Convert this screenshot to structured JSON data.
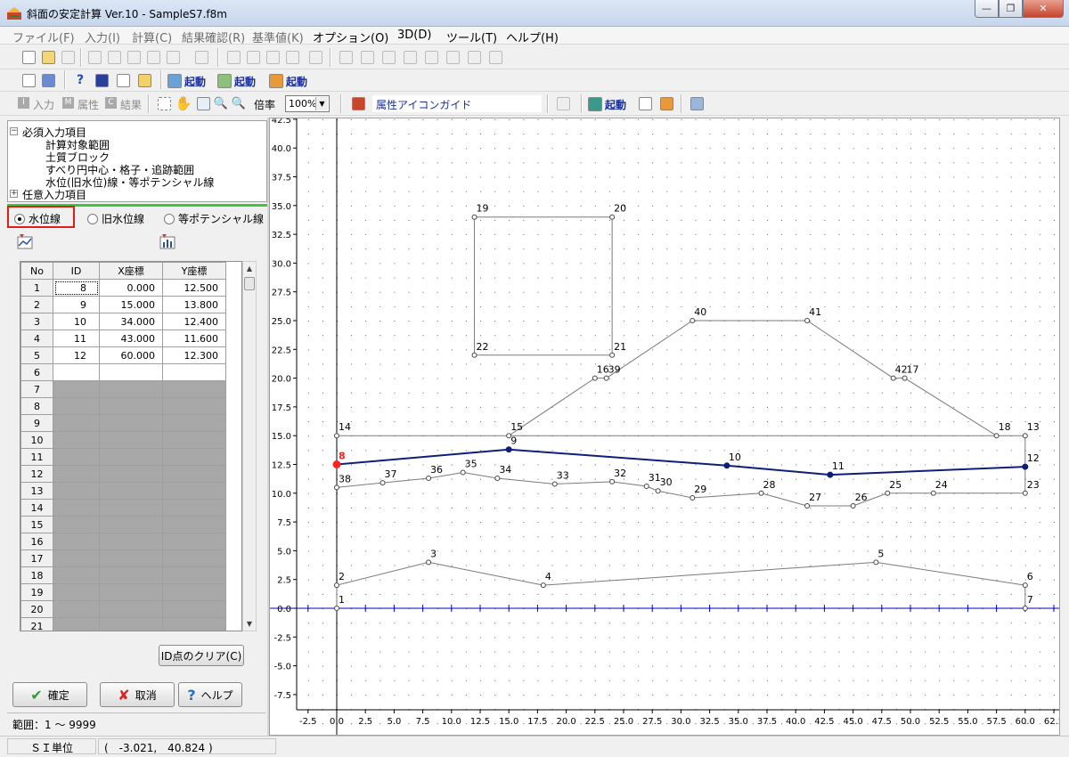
{
  "window": {
    "title": "斜面の安定計算 Ver.10 - SampleS7.f8m",
    "minimize": "—",
    "maximize": "❐",
    "close": "✕"
  },
  "menu": [
    "ファイル(F)",
    "入力(I)",
    "計算(C)",
    "結果確認(R)",
    "基準値(K)",
    "オプション(O)",
    "3D(D)",
    "ツール(T)",
    "ヘルプ(H)"
  ],
  "toolbar": {
    "kido1": "起動",
    "kido2": "起動",
    "kido3": "起動",
    "kido4": "起動",
    "input_label": "入力",
    "attr_label": "属性",
    "result_label": "結果",
    "scale_label": "倍率",
    "scale_value": "100%",
    "guide_label": "属性アイコンガイド"
  },
  "tree": {
    "root1": "必須入力項目",
    "child1": "計算対象範囲",
    "child2": "土質ブロック",
    "child3": "すべり円中心・格子・追跡範囲",
    "child4": "水位(旧水位)線・等ポテンシャル線",
    "root2": "任意入力項目"
  },
  "radios": {
    "r1": "水位線",
    "r2": "旧水位線",
    "r3": "等ポテンシャル線"
  },
  "table": {
    "headers": [
      "No",
      "ID",
      "X座標",
      "Y座標"
    ],
    "rows": [
      {
        "no": "1",
        "id": "8",
        "x": "0.000",
        "y": "12.500"
      },
      {
        "no": "2",
        "id": "9",
        "x": "15.000",
        "y": "13.800"
      },
      {
        "no": "3",
        "id": "10",
        "x": "34.000",
        "y": "12.400"
      },
      {
        "no": "4",
        "id": "11",
        "x": "43.000",
        "y": "11.600"
      },
      {
        "no": "5",
        "id": "12",
        "x": "60.000",
        "y": "12.300"
      },
      {
        "no": "6",
        "id": "",
        "x": "",
        "y": ""
      },
      {
        "no": "7"
      },
      {
        "no": "8"
      },
      {
        "no": "9"
      },
      {
        "no": "10"
      },
      {
        "no": "11"
      },
      {
        "no": "12"
      },
      {
        "no": "13"
      },
      {
        "no": "14"
      },
      {
        "no": "15"
      },
      {
        "no": "16"
      },
      {
        "no": "17"
      },
      {
        "no": "18"
      },
      {
        "no": "19"
      },
      {
        "no": "20"
      },
      {
        "no": "21"
      }
    ]
  },
  "buttons": {
    "clear": "ID点のクリア(C)",
    "ok": "確定",
    "cancel": "取消",
    "help": "ヘルプ"
  },
  "range_text": "範囲：1 ～ 9999",
  "status": {
    "unit": "ＳＩ単位",
    "coords": "(　-3.021,　40.824 )"
  },
  "plot": {
    "x_ticks": [
      "-2.5",
      "0.0",
      "2.5",
      "5.0",
      "7.5",
      "10.0",
      "12.5",
      "15.0",
      "17.5",
      "20.0",
      "22.5",
      "25.0",
      "27.5",
      "30.0",
      "32.5",
      "35.0",
      "37.5",
      "40.0",
      "42.5",
      "45.0",
      "47.5",
      "50.0",
      "52.5",
      "55.0",
      "57.5",
      "60.0",
      "62.5"
    ],
    "y_ticks": [
      "42.5",
      "40.0",
      "37.5",
      "35.0",
      "32.5",
      "30.0",
      "27.5",
      "25.0",
      "22.5",
      "20.0",
      "17.5",
      "15.0",
      "12.5",
      "10.0",
      "7.5",
      "5.0",
      "2.5",
      "0.0",
      "-2.5",
      "-5.0",
      "-7.5"
    ],
    "points": [
      {
        "id": "1",
        "x": 0,
        "y": 0
      },
      {
        "id": "2",
        "x": 0,
        "y": 2
      },
      {
        "id": "3",
        "x": 8,
        "y": 4
      },
      {
        "id": "4",
        "x": 18,
        "y": 2
      },
      {
        "id": "5",
        "x": 47,
        "y": 4
      },
      {
        "id": "6",
        "x": 60,
        "y": 2
      },
      {
        "id": "7",
        "x": 60,
        "y": 0
      },
      {
        "id": "8",
        "x": 0,
        "y": 12.5
      },
      {
        "id": "9",
        "x": 15,
        "y": 13.8
      },
      {
        "id": "10",
        "x": 34,
        "y": 12.4
      },
      {
        "id": "11",
        "x": 43,
        "y": 11.6
      },
      {
        "id": "12",
        "x": 60,
        "y": 12.3
      },
      {
        "id": "13",
        "x": 60,
        "y": 15
      },
      {
        "id": "14",
        "x": 0,
        "y": 15
      },
      {
        "id": "15",
        "x": 15,
        "y": 15
      },
      {
        "id": "16",
        "x": 22.5,
        "y": 20
      },
      {
        "id": "39",
        "x": 23.5,
        "y": 20
      },
      {
        "id": "40",
        "x": 31,
        "y": 25
      },
      {
        "id": "41",
        "x": 41,
        "y": 25
      },
      {
        "id": "42",
        "x": 48.5,
        "y": 20
      },
      {
        "id": "17",
        "x": 49.5,
        "y": 20
      },
      {
        "id": "18",
        "x": 57.5,
        "y": 15
      },
      {
        "id": "19",
        "x": 12,
        "y": 34
      },
      {
        "id": "20",
        "x": 24,
        "y": 34
      },
      {
        "id": "21",
        "x": 24,
        "y": 22
      },
      {
        "id": "22",
        "x": 12,
        "y": 22
      },
      {
        "id": "38",
        "x": 0,
        "y": 10.5
      },
      {
        "id": "37",
        "x": 4,
        "y": 10.9
      },
      {
        "id": "36",
        "x": 8,
        "y": 11.3
      },
      {
        "id": "35",
        "x": 11,
        "y": 11.8
      },
      {
        "id": "34",
        "x": 14,
        "y": 11.3
      },
      {
        "id": "33",
        "x": 19,
        "y": 10.8
      },
      {
        "id": "32",
        "x": 24,
        "y": 11
      },
      {
        "id": "31",
        "x": 27,
        "y": 10.6
      },
      {
        "id": "30",
        "x": 28,
        "y": 10.2
      },
      {
        "id": "29",
        "x": 31,
        "y": 9.6
      },
      {
        "id": "28",
        "x": 37,
        "y": 10
      },
      {
        "id": "27",
        "x": 41,
        "y": 8.9
      },
      {
        "id": "26",
        "x": 45,
        "y": 8.9
      },
      {
        "id": "25",
        "x": 48,
        "y": 10
      },
      {
        "id": "24",
        "x": 52,
        "y": 10
      },
      {
        "id": "23",
        "x": 60,
        "y": 10
      }
    ],
    "lines": [
      [
        "1",
        "2",
        "3",
        "4",
        "5",
        "6",
        "7"
      ],
      [
        "38",
        "37",
        "36",
        "35",
        "34",
        "33",
        "32",
        "31",
        "30",
        "29",
        "28",
        "27",
        "26",
        "25",
        "24",
        "23"
      ],
      [
        "14",
        "15",
        "13"
      ],
      [
        "15",
        "16",
        "39",
        "40",
        "41",
        "42",
        "17",
        "18"
      ],
      [
        "19",
        "20",
        "21",
        "22",
        "19"
      ],
      [
        "23",
        "13"
      ]
    ],
    "water_line": [
      "8",
      "9",
      "10",
      "11",
      "12"
    ],
    "colors": {
      "water": "#0d1f7a",
      "line": "#7a7a7a",
      "axis": "#0000cc",
      "selected": "#ff2020"
    }
  }
}
